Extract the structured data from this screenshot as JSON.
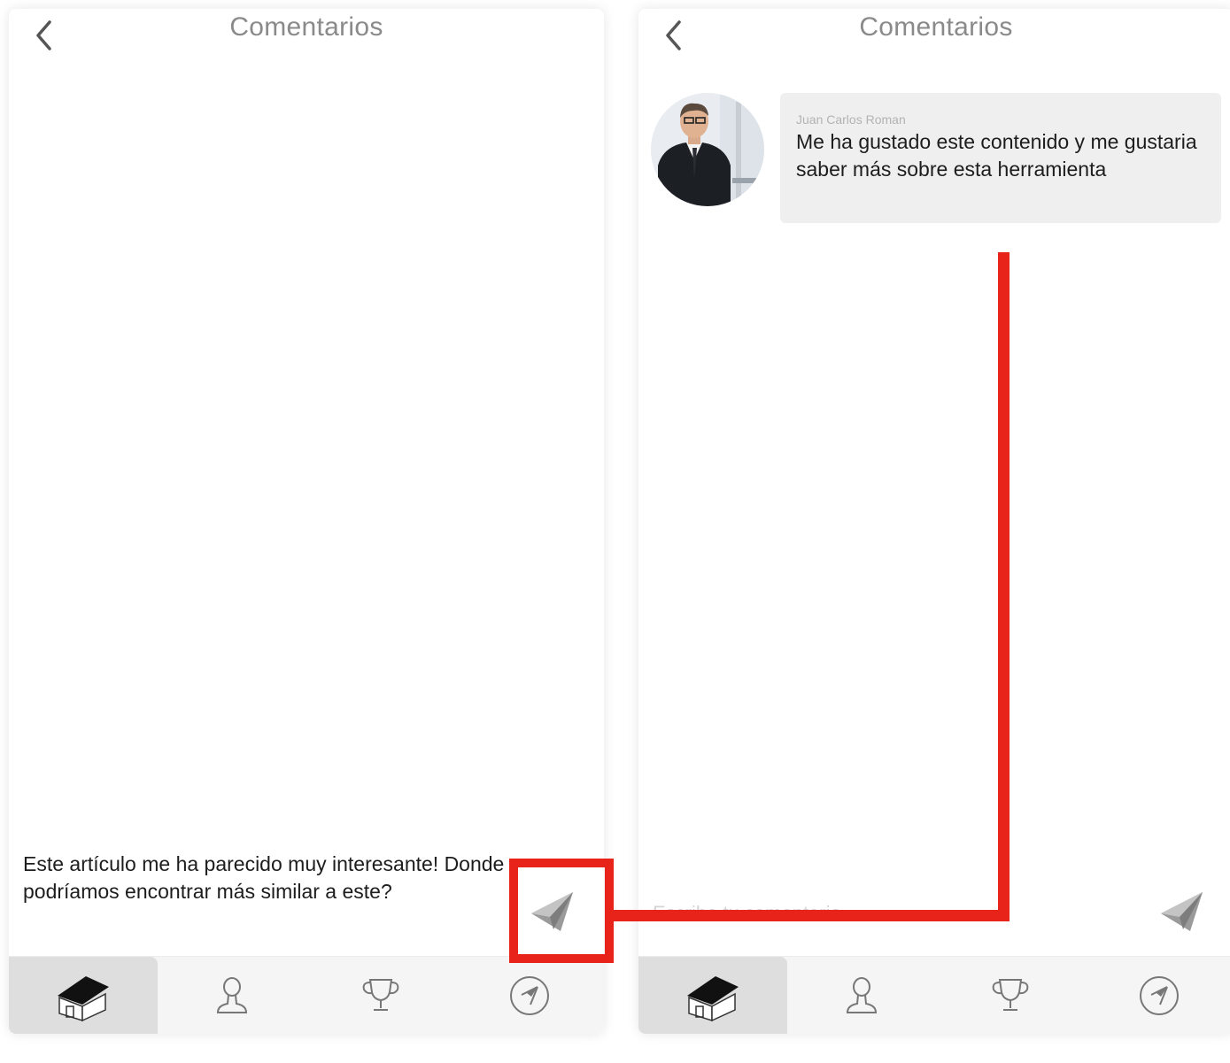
{
  "left_screen": {
    "header": {
      "title": "Comentarios"
    },
    "composer": {
      "text": "Este artículo me ha parecido muy interesante! Donde podríamos encontrar más similar a este?"
    }
  },
  "right_screen": {
    "header": {
      "title": "Comentarios"
    },
    "comment": {
      "author": "Juan Carlos Roman",
      "text": "Me ha gustado este contenido y me gustaria saber más sobre esta herramienta"
    },
    "composer": {
      "placeholder": "Escribe tu comentario"
    }
  },
  "tabbar": {
    "items": [
      {
        "icon": "home-icon",
        "active": true
      },
      {
        "icon": "profile-icon",
        "active": false
      },
      {
        "icon": "trophy-icon",
        "active": false
      },
      {
        "icon": "compass-icon",
        "active": false
      }
    ]
  },
  "colors": {
    "annotation_red": "#e8231a",
    "title_gray": "#8a8a8a",
    "bubble_bg": "#efefef",
    "tabbar_bg": "#f5f5f5",
    "tab_active_bg": "#dedede"
  }
}
